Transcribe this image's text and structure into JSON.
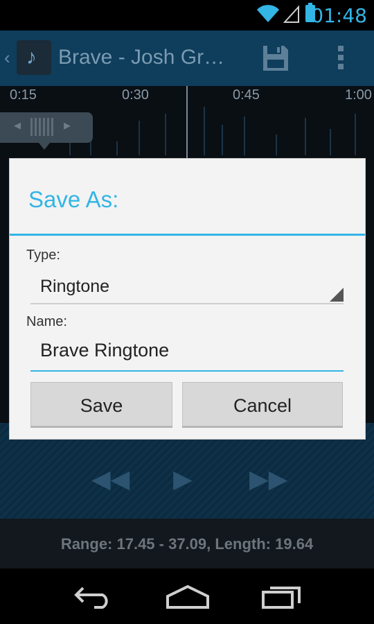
{
  "status_bar": {
    "time": "01:48"
  },
  "action_bar": {
    "title": "Brave - Josh Gro…"
  },
  "timeline": {
    "ticks": [
      "0:15",
      "0:30",
      "0:45",
      "1:00"
    ]
  },
  "range_info": "Range: 17.45 - 37.09, Length: 19.64",
  "dialog": {
    "title": "Save As:",
    "type_label": "Type:",
    "type_value": "Ringtone",
    "name_label": "Name:",
    "name_value": "Brave Ringtone",
    "save_label": "Save",
    "cancel_label": "Cancel"
  },
  "icons": {
    "status": [
      "wifi-icon",
      "signal-icon",
      "battery-icon"
    ],
    "action_bar": [
      "back-icon",
      "app-icon",
      "save-icon",
      "overflow-menu-icon"
    ],
    "transport": [
      "rewind-icon",
      "play-icon",
      "fast-forward-icon"
    ],
    "nav": [
      "nav-back-icon",
      "nav-home-icon",
      "nav-recents-icon"
    ]
  },
  "colors": {
    "accent": "#33b5e5",
    "action_bar_bg": "#0f3d5c",
    "dialog_bg": "#f3f3f3",
    "button_bg": "#d8d8d8"
  }
}
